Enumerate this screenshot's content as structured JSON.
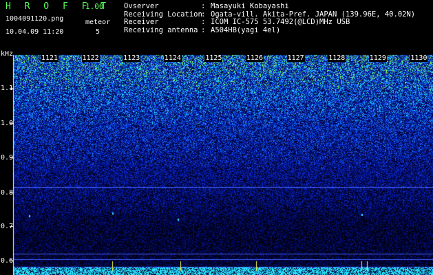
{
  "header": {
    "app_title": "H R O F F T",
    "app_version": "1.00",
    "filename": "1004091120.png",
    "datetime": "10.04.09 11:20",
    "meteor_label": "meteor",
    "meteor_count": "5"
  },
  "station": [
    {
      "key": "Ovserver",
      "value": "Masayuki Kobayashi"
    },
    {
      "key": "Receiving Location",
      "value": "Ogata-vill. Akita-Pref. JAPAN (139.96E, 40.02N)"
    },
    {
      "key": "Receiver",
      "value": "ICOM IC-575 53.7492(@LCD)MHz USB"
    },
    {
      "key": "Receiving antenna",
      "value": "A504HB(yagi 4el)"
    }
  ],
  "plot": {
    "unit_label": "kHz",
    "y_labels": [
      "1.1",
      "1.0",
      "0.9",
      "0.8",
      "0.7",
      "0.6"
    ],
    "minute_labels": [
      "1121",
      "1122",
      "1123",
      "1124",
      "1125",
      "1126",
      "1127",
      "1128",
      "1129",
      "1130"
    ],
    "colors": {
      "background": "#000000",
      "signal_low": "#0a1a9a",
      "signal_mid": "#1e5cff",
      "signal_high": "#30e0ff",
      "peak": "#a0ff40",
      "line": "#4060ff"
    }
  }
}
